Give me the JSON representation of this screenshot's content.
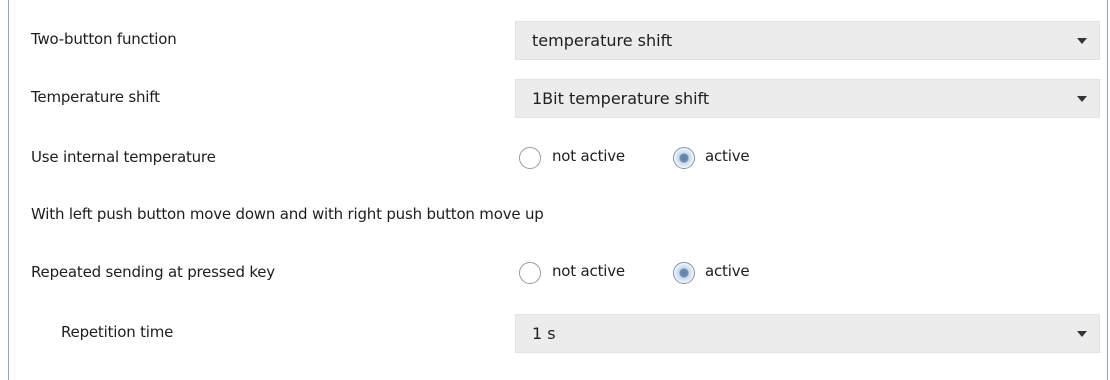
{
  "params": {
    "two_button_function": {
      "label": "Two-button function",
      "value": "temperature shift",
      "dropdown_icon": "chevron-down-icon"
    },
    "temperature_shift": {
      "label": "Temperature shift",
      "value": "1Bit temperature shift",
      "dropdown_icon": "chevron-down-icon"
    },
    "use_internal_temperature": {
      "label": "Use internal temperature",
      "options": [
        "not active",
        "active"
      ],
      "selected": "active"
    },
    "info_text": "With left push button move down and with right push button move up",
    "repeated_sending": {
      "label": "Repeated sending at pressed key",
      "options": [
        "not active",
        "active"
      ],
      "selected": "active"
    },
    "repetition_time": {
      "label": "Repetition time",
      "value": "1 s",
      "dropdown_icon": "chevron-down-icon"
    }
  },
  "colors": {
    "dropdown_bg": "#ececec",
    "radio_selected": "#6d8cb3",
    "frame_border": "#8aa6c8"
  }
}
